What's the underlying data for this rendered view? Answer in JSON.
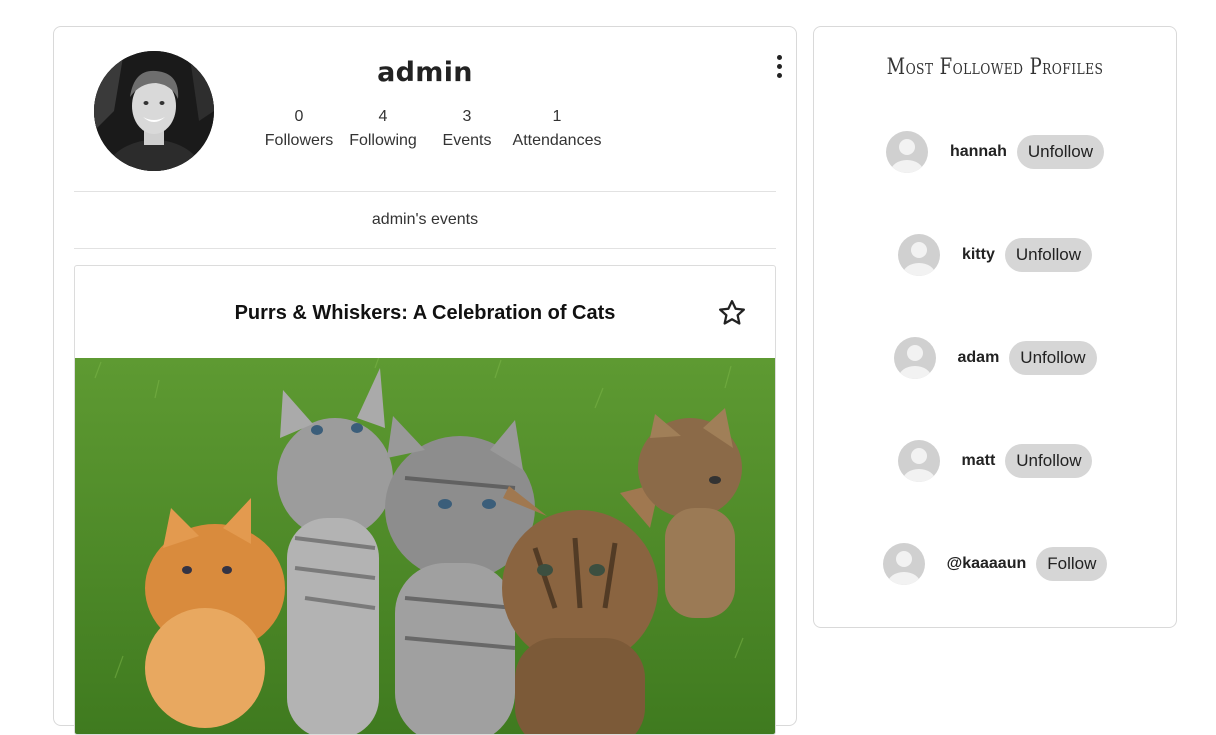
{
  "profile": {
    "username": "admin",
    "stats": [
      {
        "value": "0",
        "label": "Followers"
      },
      {
        "value": "4",
        "label": "Following"
      },
      {
        "value": "3",
        "label": "Events"
      },
      {
        "value": "1",
        "label": "Attendances"
      }
    ],
    "events_heading": "admin's events"
  },
  "event": {
    "title": "Purrs & Whiskers: A Celebration of Cats",
    "favorite_icon": "star-outline-icon"
  },
  "most_followed": {
    "title": "Most Followed Profiles",
    "profiles": [
      {
        "name": "hannah",
        "action": "Unfollow"
      },
      {
        "name": "kitty",
        "action": "Unfollow"
      },
      {
        "name": "adam",
        "action": "Unfollow"
      },
      {
        "name": "matt",
        "action": "Unfollow"
      },
      {
        "name": "@kaaaaun",
        "action": "Follow"
      }
    ]
  },
  "colors": {
    "pill_bg": "#d6d6d6",
    "card_border": "#d9d9d9",
    "grass": "#4f8a2a"
  }
}
